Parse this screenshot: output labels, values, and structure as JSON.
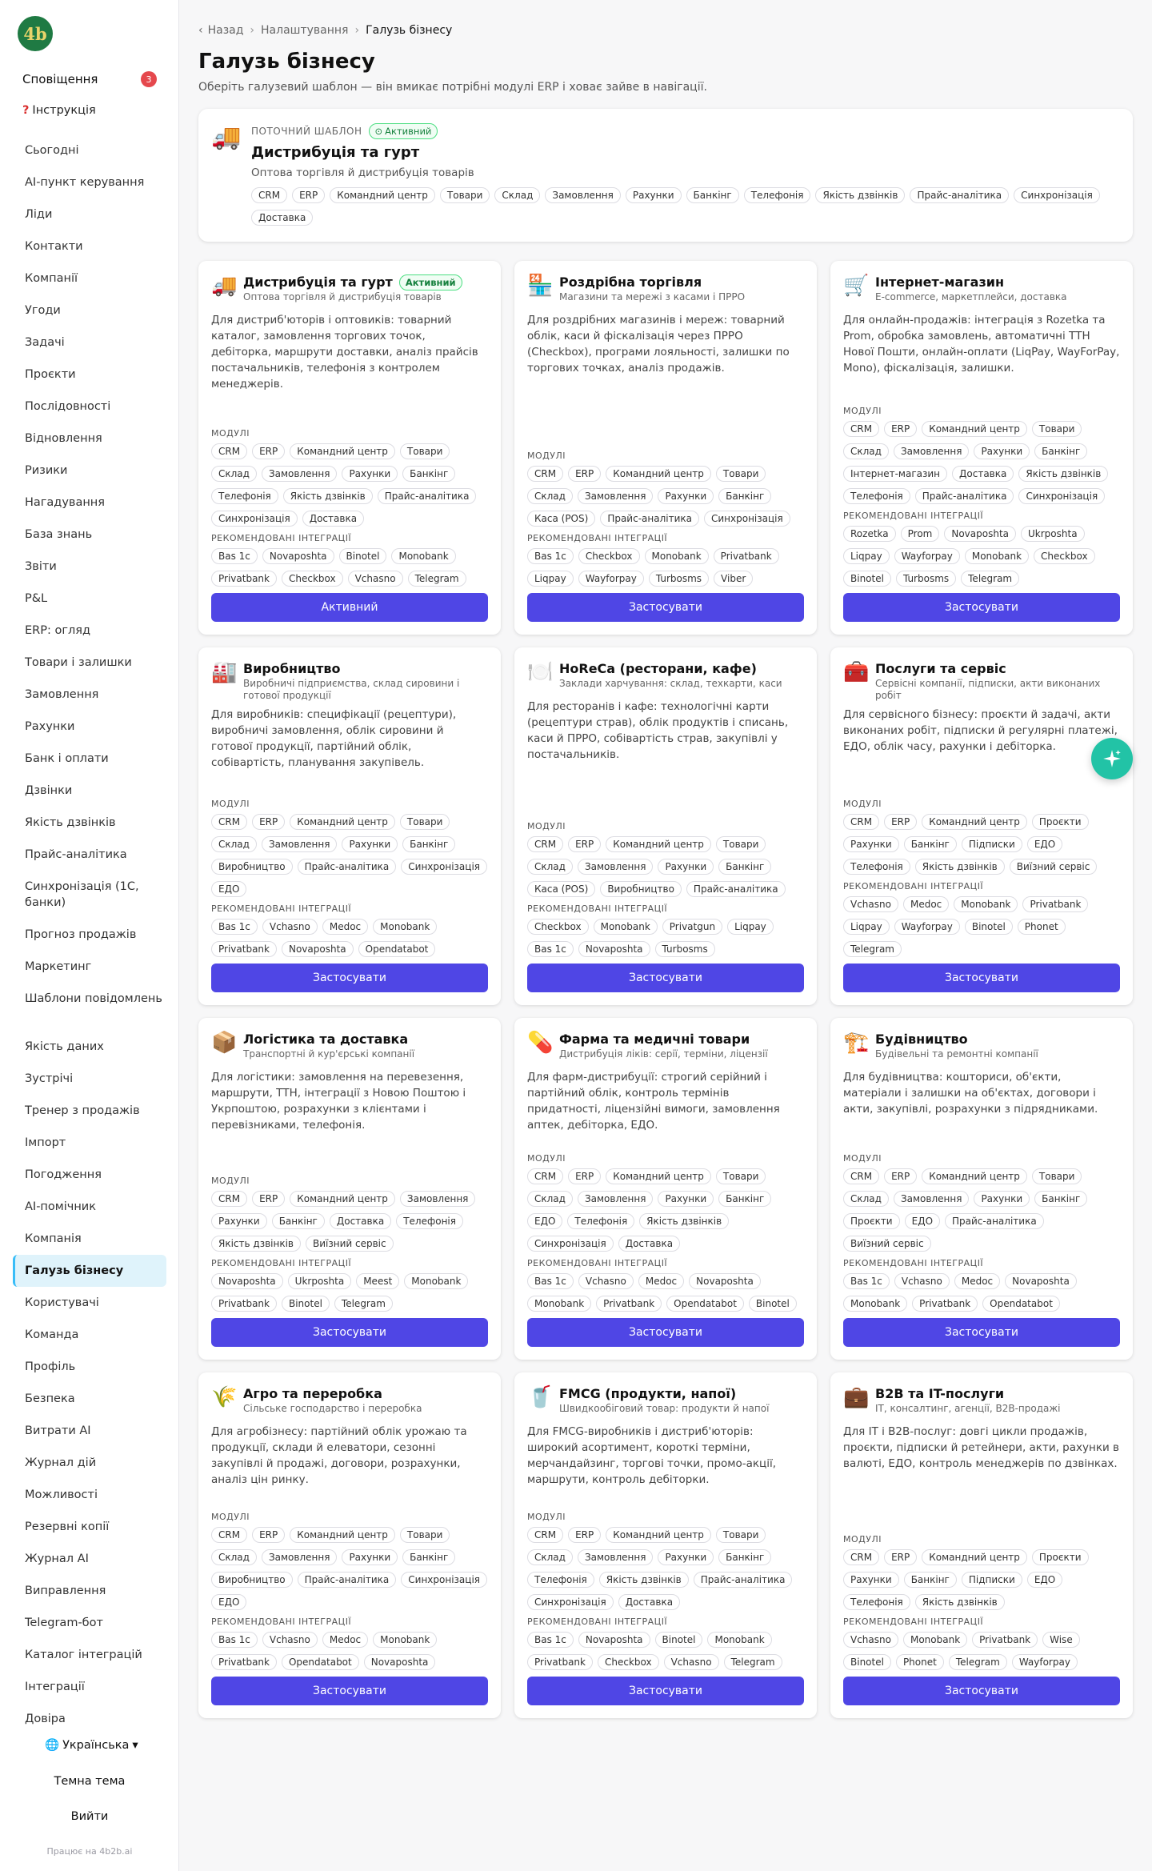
{
  "brand": {
    "logo_text": "4b"
  },
  "sidebar": {
    "notifications_label": "Сповіщення",
    "notifications_count": "3",
    "help_label": "Інструкція",
    "items": [
      "Сьогодні",
      "AI-пункт керування",
      "Ліди",
      "Контакти",
      "Компанії",
      "Угоди",
      "Задачі",
      "Проєкти",
      "Послідовності",
      "Відновлення",
      "Ризики",
      "Нагадування",
      "База знань",
      "Звіти",
      "P&L",
      "ERP: огляд",
      "Товари і залишки",
      "Замовлення",
      "Рахунки",
      "Банк і оплати",
      "Дзвінки",
      "Якість дзвінків",
      "Прайс-аналітика",
      "Синхронізація (1С, банки)",
      "Прогноз продажів",
      "Маркетинг",
      "Шаблони повідомлень",
      "Якість даних",
      "Зустрічі",
      "Тренер з продажів",
      "Імпорт",
      "Погодження",
      "AI-помічник",
      "Компанія",
      "Галузь бізнесу",
      "Користувачі",
      "Команда",
      "Профіль",
      "Безпека",
      "Витрати AI",
      "Журнал дій",
      "Можливості",
      "Резервні копії",
      "Журнал AI",
      "Виправлення",
      "Telegram-бот",
      "Каталог інтеграцій",
      "Інтеграції",
      "Довіра"
    ],
    "active_item": "Галузь бізнесу",
    "language": "Українська",
    "theme": "Темна тема",
    "logout": "Вийти",
    "powered": "Працює на 4b2b.ai"
  },
  "breadcrumb": {
    "back": "Назад",
    "settings": "Налаштування",
    "current": "Галузь бізнесу"
  },
  "page": {
    "title": "Галузь бізнесу",
    "subtitle": "Оберіть галузевий шаблон — він вмикає потрібні модулі ERP і ховає зайве в навігації."
  },
  "current_template": {
    "label": "ПОТОЧНИЙ ШАБЛОН",
    "badge": "Активний",
    "name": "Дистрибуція та гурт",
    "description": "Оптова торгівля й дистрибуція товарів",
    "modules": [
      "CRM",
      "ERP",
      "Командний центр",
      "Товари",
      "Склад",
      "Замовлення",
      "Рахунки",
      "Банкінг",
      "Телефонія",
      "Якість дзвінків",
      "Прайс-аналітика",
      "Синхронізація",
      "Доставка"
    ]
  },
  "labels": {
    "modules": "МОДУЛІ",
    "integrations": "РЕКОМЕНДОВАНІ ІНТЕГРАЦІЇ",
    "apply": "Застосувати",
    "active": "Активний"
  },
  "templates": [
    {
      "icon": "truck-icon",
      "emoji": "🚚",
      "name": "Дистрибуція та гурт",
      "active": true,
      "active_badge": "Активний",
      "button": "Активний",
      "tagline": "Оптова торгівля й дистрибуція товарів",
      "description": "Для дистриб'юторів і оптовиків: товарний каталог, замовлення торгових точок, дебіторка, маршрути доставки, аналіз прайсів постачальників, телефонія з контролем менеджерів.",
      "modules": [
        "CRM",
        "ERP",
        "Командний центр",
        "Товари",
        "Склад",
        "Замовлення",
        "Рахунки",
        "Банкінг",
        "Телефонія",
        "Якість дзвінків",
        "Прайс-аналітика",
        "Синхронізація",
        "Доставка"
      ],
      "integrations": [
        "Bas 1c",
        "Novaposhta",
        "Binotel",
        "Monobank",
        "Privatbank",
        "Checkbox",
        "Vchasno",
        "Telegram"
      ]
    },
    {
      "icon": "store-icon",
      "emoji": "🏪",
      "name": "Роздрібна торгівля",
      "active": false,
      "button": "Застосувати",
      "tagline": "Магазини та мережі з касами і ПРРО",
      "description": "Для роздрібних магазинів і мереж: товарний облік, каси й фіскалізація через ПРРО (Checkbox), програми лояльності, залишки по торгових точках, аналіз продажів.",
      "modules": [
        "CRM",
        "ERP",
        "Командний центр",
        "Товари",
        "Склад",
        "Замовлення",
        "Рахунки",
        "Банкінг",
        "Каса (POS)",
        "Прайс-аналітика",
        "Синхронізація"
      ],
      "integrations": [
        "Bas 1c",
        "Checkbox",
        "Monobank",
        "Privatbank",
        "Liqpay",
        "Wayforpay",
        "Turbosms",
        "Viber"
      ]
    },
    {
      "icon": "cart-icon",
      "emoji": "🛒",
      "name": "Інтернет-магазин",
      "active": false,
      "button": "Застосувати",
      "tagline": "E-commerce, маркетплейси, доставка",
      "description": "Для онлайн-продажів: інтеграція з Rozetka та Prom, обробка замовлень, автоматичні ТТН Нової Пошти, онлайн-оплати (LiqPay, WayForPay, Mono), фіскалізація, залишки.",
      "modules": [
        "CRM",
        "ERP",
        "Командний центр",
        "Товари",
        "Склад",
        "Замовлення",
        "Рахунки",
        "Банкінг",
        "Інтернет-магазин",
        "Доставка",
        "Якість дзвінків",
        "Телефонія",
        "Прайс-аналітика",
        "Синхронізація"
      ],
      "integrations": [
        "Rozetka",
        "Prom",
        "Novaposhta",
        "Ukrposhta",
        "Liqpay",
        "Wayforpay",
        "Monobank",
        "Checkbox",
        "Binotel",
        "Turbosms",
        "Telegram"
      ]
    },
    {
      "icon": "factory-icon",
      "emoji": "🏭",
      "name": "Виробництво",
      "active": false,
      "button": "Застосувати",
      "tagline": "Виробничі підприємства, склад сировини і готової продукції",
      "description": "Для виробників: специфікації (рецептури), виробничі замовлення, облік сировини й готової продукції, партійний облік, собівартість, планування закупівель.",
      "modules": [
        "CRM",
        "ERP",
        "Командний центр",
        "Товари",
        "Склад",
        "Замовлення",
        "Рахунки",
        "Банкінг",
        "Виробництво",
        "Прайс-аналітика",
        "Синхронізація",
        "ЕДО"
      ],
      "integrations": [
        "Bas 1c",
        "Vchasno",
        "Medoc",
        "Monobank",
        "Privatbank",
        "Novaposhta",
        "Opendatabot"
      ]
    },
    {
      "icon": "plate-icon",
      "emoji": "🍽️",
      "name": "HoReCa (ресторани, кафе)",
      "active": false,
      "button": "Застосувати",
      "tagline": "Заклади харчування: склад, техкарти, каси",
      "description": "Для ресторанів і кафе: технологічні карти (рецептури страв), облік продуктів і списань, каси й ПРРО, собівартість страв, закупівлі у постачальників.",
      "modules": [
        "CRM",
        "ERP",
        "Командний центр",
        "Товари",
        "Склад",
        "Замовлення",
        "Рахунки",
        "Банкінг",
        "Каса (POS)",
        "Виробництво",
        "Прайс-аналітика"
      ],
      "integrations": [
        "Checkbox",
        "Monobank",
        "Privatgun",
        "Liqpay",
        "Bas 1c",
        "Novaposhta",
        "Turbosms"
      ]
    },
    {
      "icon": "toolbox-icon",
      "emoji": "🧰",
      "name": "Послуги та сервіс",
      "active": false,
      "button": "Застосувати",
      "tagline": "Сервісні компанії, підписки, акти виконаних робіт",
      "description": "Для сервісного бізнесу: проєкти й задачі, акти виконаних робіт, підписки й регулярні платежі, ЕДО, облік часу, рахунки і дебіторка.",
      "modules": [
        "CRM",
        "ERP",
        "Командний центр",
        "Проєкти",
        "Рахунки",
        "Банкінг",
        "Підписки",
        "ЕДО",
        "Телефонія",
        "Якість дзвінків",
        "Виїзний сервіс"
      ],
      "integrations": [
        "Vchasno",
        "Medoc",
        "Monobank",
        "Privatbank",
        "Liqpay",
        "Wayforpay",
        "Binotel",
        "Phonet",
        "Telegram"
      ]
    },
    {
      "icon": "package-icon",
      "emoji": "📦",
      "name": "Логістика та доставка",
      "active": false,
      "button": "Застосувати",
      "tagline": "Транспортні й кур'єрські компанії",
      "description": "Для логістики: замовлення на перевезення, маршрути, ТТН, інтеграції з Новою Поштою і Укрпоштою, розрахунки з клієнтами і перевізниками, телефонія.",
      "modules": [
        "CRM",
        "ERP",
        "Командний центр",
        "Замовлення",
        "Рахунки",
        "Банкінг",
        "Доставка",
        "Телефонія",
        "Якість дзвінків",
        "Виїзний сервіс"
      ],
      "integrations": [
        "Novaposhta",
        "Ukrposhta",
        "Meest",
        "Monobank",
        "Privatbank",
        "Binotel",
        "Telegram"
      ]
    },
    {
      "icon": "pill-icon",
      "emoji": "💊",
      "name": "Фарма та медичні товари",
      "active": false,
      "button": "Застосувати",
      "tagline": "Дистрибуція ліків: серії, терміни, ліцензії",
      "description": "Для фарм-дистрибуції: строгий серійний і партійний облік, контроль термінів придатності, ліцензійні вимоги, замовлення аптек, дебіторка, ЕДО.",
      "modules": [
        "CRM",
        "ERP",
        "Командний центр",
        "Товари",
        "Склад",
        "Замовлення",
        "Рахунки",
        "Банкінг",
        "ЕДО",
        "Телефонія",
        "Якість дзвінків",
        "Синхронізація",
        "Доставка"
      ],
      "integrations": [
        "Bas 1c",
        "Vchasno",
        "Medoc",
        "Novaposhta",
        "Monobank",
        "Privatbank",
        "Opendatabot",
        "Binotel"
      ]
    },
    {
      "icon": "crane-icon",
      "emoji": "🏗️",
      "name": "Будівництво",
      "active": false,
      "button": "Застосувати",
      "tagline": "Будівельні та ремонтні компанії",
      "description": "Для будівництва: кошториси, об'єкти, матеріали і залишки на об'єктах, договори і акти, закупівлі, розрахунки з підрядниками.",
      "modules": [
        "CRM",
        "ERP",
        "Командний центр",
        "Товари",
        "Склад",
        "Замовлення",
        "Рахунки",
        "Банкінг",
        "Проєкти",
        "ЕДО",
        "Прайс-аналітика",
        "Виїзний сервіс"
      ],
      "integrations": [
        "Bas 1c",
        "Vchasno",
        "Medoc",
        "Novaposhta",
        "Monobank",
        "Privatbank",
        "Opendatabot"
      ]
    },
    {
      "icon": "wheat-icon",
      "emoji": "🌾",
      "name": "Агро та переробка",
      "active": false,
      "button": "Застосувати",
      "tagline": "Сільське господарство і переробка",
      "description": "Для агробізнесу: партійний облік урожаю та продукції, склади й елеватори, сезонні закупівлі й продажі, договори, розрахунки, аналіз цін ринку.",
      "modules": [
        "CRM",
        "ERP",
        "Командний центр",
        "Товари",
        "Склад",
        "Замовлення",
        "Рахунки",
        "Банкінг",
        "Виробництво",
        "Прайс-аналітика",
        "Синхронізація",
        "ЕДО"
      ],
      "integrations": [
        "Bas 1c",
        "Vchasno",
        "Medoc",
        "Monobank",
        "Privatbank",
        "Opendatabot",
        "Novaposhta"
      ]
    },
    {
      "icon": "cup-icon",
      "emoji": "🥤",
      "name": "FMCG (продукти, напої)",
      "active": false,
      "button": "Застосувати",
      "tagline": "Швидкообіговий товар: продукти й напої",
      "description": "Для FMCG-виробників і дистриб'юторів: широкий асортимент, короткі терміни, мерчандайзинг, торгові точки, промо-акції, маршрути, контроль дебіторки.",
      "modules": [
        "CRM",
        "ERP",
        "Командний центр",
        "Товари",
        "Склад",
        "Замовлення",
        "Рахунки",
        "Банкінг",
        "Телефонія",
        "Якість дзвінків",
        "Прайс-аналітика",
        "Синхронізація",
        "Доставка"
      ],
      "integrations": [
        "Bas 1c",
        "Novaposhta",
        "Binotel",
        "Monobank",
        "Privatbank",
        "Checkbox",
        "Vchasno",
        "Telegram"
      ]
    },
    {
      "icon": "briefcase-icon",
      "emoji": "💼",
      "name": "B2B та IT-послуги",
      "active": false,
      "button": "Застосувати",
      "tagline": "IT, консалтинг, агенції, B2B-продажі",
      "description": "Для IT і B2B-послуг: довгі цикли продажів, проєкти, підписки й ретейнери, акти, рахунки в валюті, ЕДО, контроль менеджерів по дзвінках.",
      "modules": [
        "CRM",
        "ERP",
        "Командний центр",
        "Проєкти",
        "Рахунки",
        "Банкінг",
        "Підписки",
        "ЕДО",
        "Телефонія",
        "Якість дзвінків"
      ],
      "integrations": [
        "Vchasno",
        "Monobank",
        "Privatbank",
        "Wise",
        "Binotel",
        "Phonet",
        "Telegram",
        "Wayforpay"
      ]
    }
  ]
}
